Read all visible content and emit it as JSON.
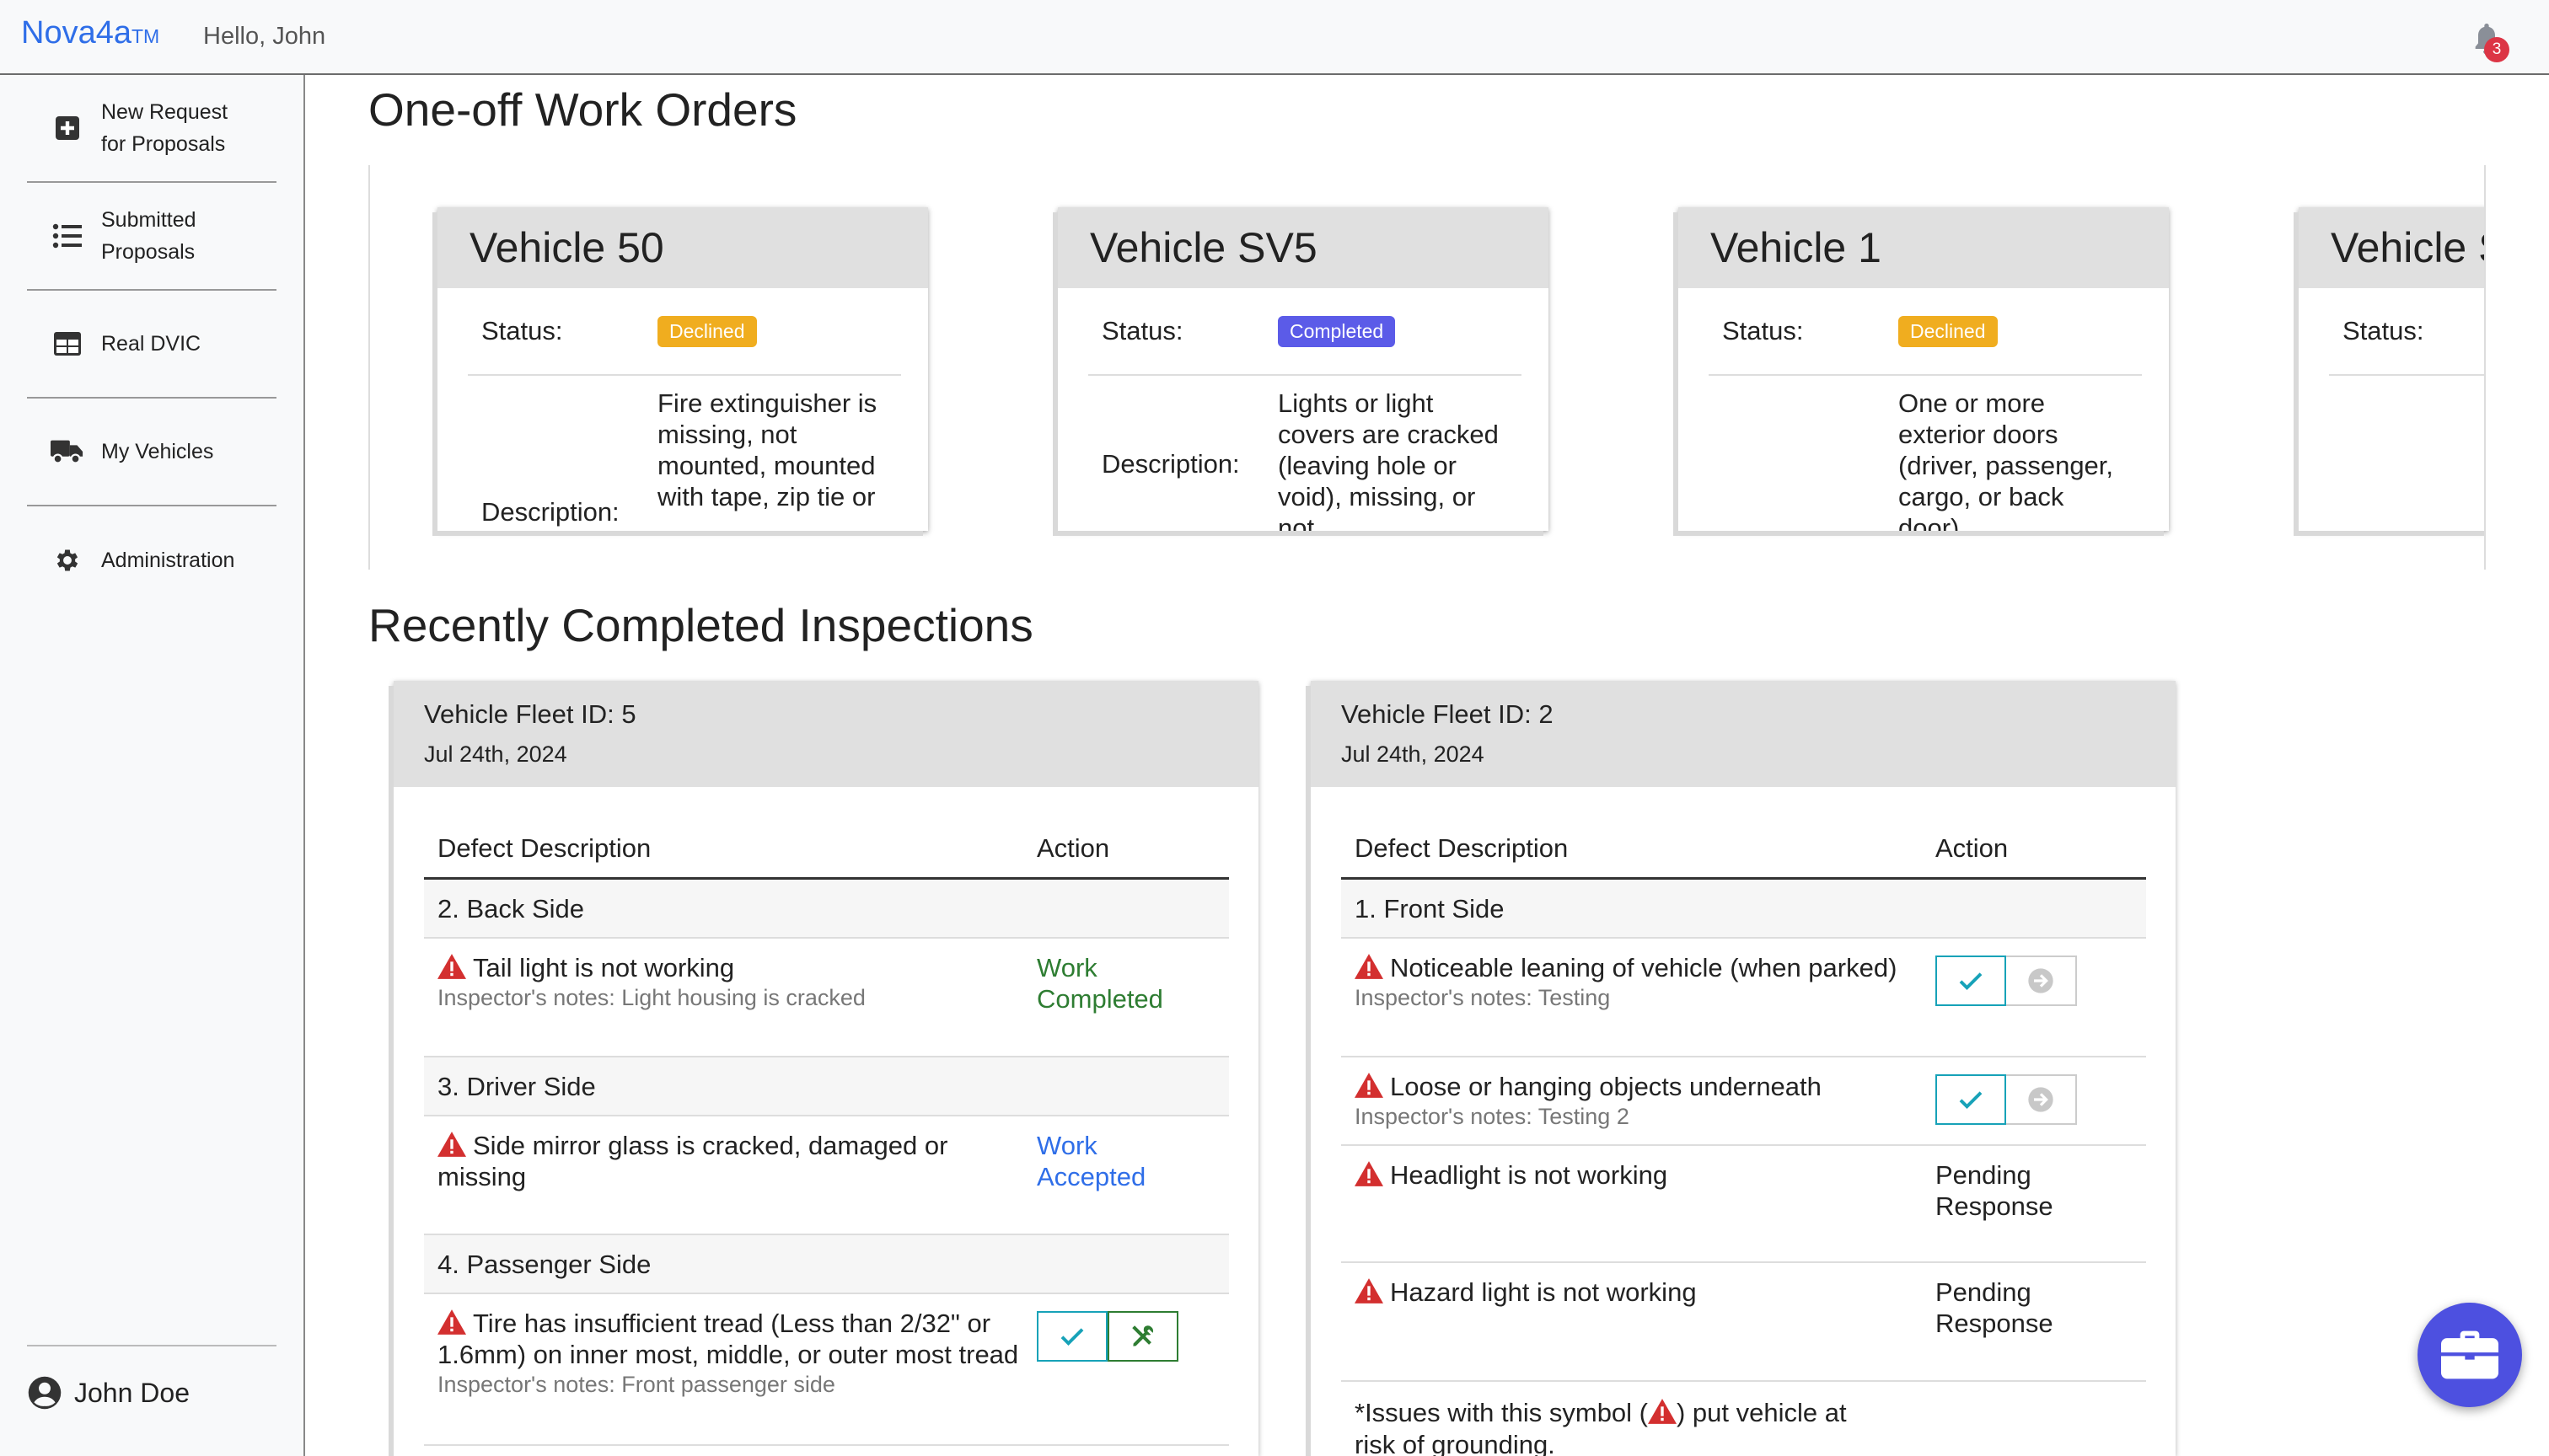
{
  "app": {
    "brand": "Nova4a",
    "brand_suffix": "TM",
    "greeting": "Hello, John",
    "notification_count": "3"
  },
  "sidebar": {
    "items": [
      {
        "label": "New Request for Proposals",
        "icon": "plus-square-icon"
      },
      {
        "label": "Submitted Proposals",
        "icon": "list-icon"
      },
      {
        "label": "Real DVIC",
        "icon": "table-icon"
      },
      {
        "label": "My Vehicles",
        "icon": "truck-icon"
      },
      {
        "label": "Administration",
        "icon": "gear-icon"
      }
    ],
    "user": "John Doe"
  },
  "work_orders": {
    "title": "One-off Work Orders",
    "status_label": "Status:",
    "description_label": "Description:",
    "cards": [
      {
        "vehicle": "Vehicle 50",
        "status": "Declined",
        "status_color": "#f0ad1f",
        "description": "Fire extinguisher is missing, not mounted, mounted with tape, zip tie or"
      },
      {
        "vehicle": "Vehicle SV5",
        "status": "Completed",
        "status_color": "#5b5be8",
        "description": "Lights or light covers are cracked (leaving hole or void), missing, or not"
      },
      {
        "vehicle": "Vehicle 1",
        "status": "Declined",
        "status_color": "#f0ad1f",
        "description": "One or more exterior doors (driver, passenger, cargo, or back door)"
      },
      {
        "vehicle": "Vehicle S",
        "status": "",
        "status_color": "",
        "description": ""
      }
    ]
  },
  "inspections": {
    "title": "Recently Completed Inspections",
    "col_defect": "Defect Description",
    "col_action": "Action",
    "cards": [
      {
        "fleet_id": "Vehicle Fleet ID: 5",
        "date": "Jul 24th, 2024",
        "sections": [
          {
            "name": "2. Back Side",
            "defects": [
              {
                "text": "Tail light is not working",
                "note": "Inspector's notes: Light housing is cracked",
                "action": "Work Completed",
                "action_color": "#2e7d32"
              }
            ]
          },
          {
            "name": "3. Driver Side",
            "defects": [
              {
                "text": "Side mirror glass is cracked, damaged or missing",
                "note": "",
                "action": "Work Accepted",
                "action_color": "#2f6ee8"
              }
            ]
          },
          {
            "name": "4. Passenger Side",
            "defects": [
              {
                "text": "Tire has insufficient tread (Less than 2/32\" or 1.6mm) on inner most, middle, or outer most tread",
                "note": "Inspector's notes: Front passenger side",
                "action": "",
                "buttons": [
                  "accept-check",
                  "repair-tools"
                ]
              }
            ]
          }
        ]
      },
      {
        "fleet_id": "Vehicle Fleet ID: 2",
        "date": "Jul 24th, 2024",
        "sections": [
          {
            "name": "1. Front Side",
            "defects": [
              {
                "text": "Noticeable leaning of vehicle (when parked)",
                "note": "Inspector's notes: Testing",
                "action": "",
                "buttons": [
                  "accept-check",
                  "forward-arrow"
                ]
              },
              {
                "text": "Loose or hanging objects underneath",
                "note": "Inspector's notes: Testing 2",
                "action": "",
                "buttons": [
                  "accept-check",
                  "forward-arrow"
                ]
              },
              {
                "text": "Headlight is not working",
                "note": "",
                "action": "Pending Response",
                "action_color": "#222222"
              },
              {
                "text": "Hazard light is not working",
                "note": "",
                "action": "Pending Response",
                "action_color": "#222222"
              }
            ]
          }
        ],
        "footnote_before": "*Issues with this symbol (",
        "footnote_after": ") put vehicle at risk of grounding."
      }
    ]
  },
  "fab": {
    "icon": "briefcase-icon"
  }
}
